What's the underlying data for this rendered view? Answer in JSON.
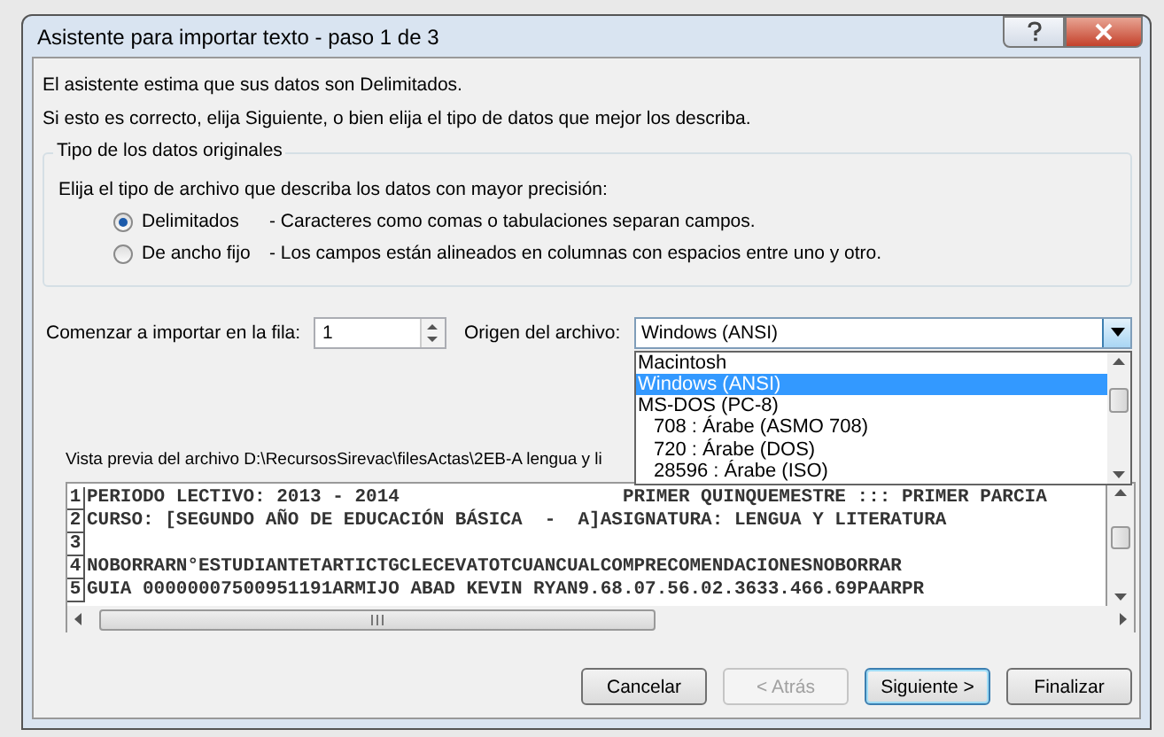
{
  "window": {
    "title": "Asistente para importar texto - paso 1 de 3"
  },
  "intro": [
    "El asistente estima que sus datos son Delimitados.",
    "Si esto es correcto, elija Siguiente, o bien elija el tipo de datos que mejor los describa."
  ],
  "group": {
    "title": "Tipo de los datos originales",
    "instruction": "Elija el tipo de archivo que describa los datos con mayor precisión:",
    "options": [
      {
        "label": "Delimitados",
        "description": "- Caracteres como comas o tabulaciones separan campos.",
        "selected": true
      },
      {
        "label": "De ancho fijo",
        "description": "- Los campos están alineados en columnas con espacios entre uno y otro.",
        "selected": false
      }
    ]
  },
  "start_row": {
    "label": "Comenzar a importar en la fila:",
    "value": "1"
  },
  "origin": {
    "label": "Origen del archivo:",
    "value": "Windows (ANSI)",
    "options": [
      {
        "label": "Macintosh",
        "kind": "family",
        "selected": false
      },
      {
        "label": "Windows (ANSI)",
        "kind": "family",
        "selected": true
      },
      {
        "label": "MS-DOS (PC-8)",
        "kind": "family",
        "selected": false
      },
      {
        "label": "708 : Árabe (ASMO 708)",
        "kind": "codepage",
        "selected": false
      },
      {
        "label": "720 : Árabe (DOS)",
        "kind": "codepage",
        "selected": false
      },
      {
        "label": "28596 : Árabe (ISO)",
        "kind": "codepage",
        "selected": false
      }
    ]
  },
  "preview": {
    "label": "Vista previa del archivo D:\\RecursosSirevac\\filesActas\\2EB-A lengua y li",
    "rows": [
      {
        "number": "1",
        "text": "PERIODO LECTIVO: 2013 - 2014                    PRIMER QUINQUEMESTRE ::: PRIMER PARCIA"
      },
      {
        "number": "2",
        "text": "CURSO: [SEGUNDO AÑO DE EDUCACIÓN BÁSICA  -  A]ASIGNATURA: LENGUA Y LITERATURA"
      },
      {
        "number": "3"
      },
      {
        "number": "4",
        "text": "NOBORRARN°ESTUDIANTETARTICTGCLECEVATOTCUANCUALCOMPRECOMENDACIONESNOBORRAR"
      },
      {
        "number": "5",
        "text": "GUIA 00000007500951191ARMIJO ABAD KEVIN RYAN9.68.07.56.02.3633.466.69PAARPR"
      }
    ]
  },
  "buttons": [
    {
      "label": "Cancelar",
      "disabled": false,
      "default": false
    },
    {
      "label": "< Atrás",
      "disabled": true,
      "default": false
    },
    {
      "label": "Siguiente >",
      "disabled": false,
      "default": true
    },
    {
      "label": "Finalizar",
      "disabled": false,
      "default": false
    }
  ]
}
